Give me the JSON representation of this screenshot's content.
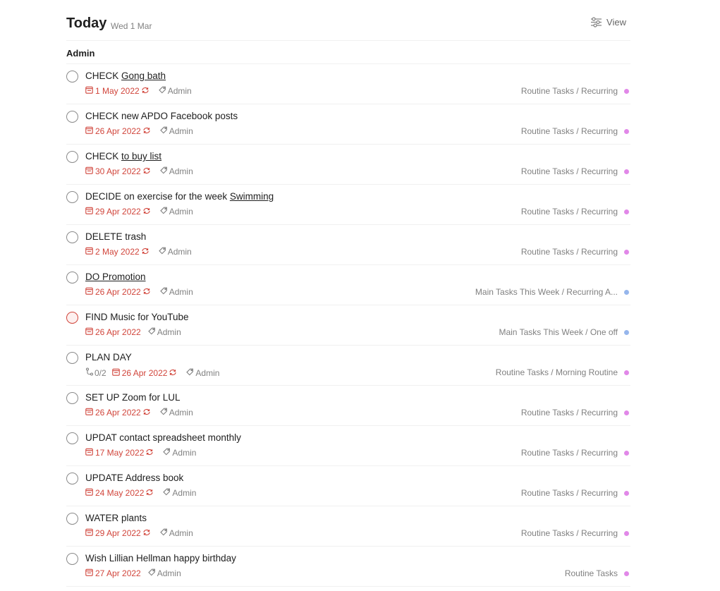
{
  "header": {
    "title": "Today",
    "date": "Wed 1 Mar",
    "view_label": "View"
  },
  "section": {
    "title": "Admin"
  },
  "colors": {
    "date_red": "#d1453b",
    "dot_purple": "#e188e8",
    "dot_blue": "#96b6ec",
    "text_gray": "#808080"
  },
  "tasks": [
    {
      "prefix": "CHECK ",
      "link": "Gong bath",
      "date": "1 May 2022",
      "recurring": true,
      "label": "Admin",
      "project": "Routine Tasks / Recurring",
      "dot": "#e188e8"
    },
    {
      "prefix": "CHECK new APDO Facebook posts",
      "link": "",
      "date": "26 Apr 2022",
      "recurring": true,
      "label": "Admin",
      "project": "Routine Tasks / Recurring",
      "dot": "#e188e8"
    },
    {
      "prefix": "CHECK ",
      "link": "to buy list",
      "date": "30 Apr 2022",
      "recurring": true,
      "label": "Admin",
      "project": "Routine Tasks / Recurring",
      "dot": "#e188e8"
    },
    {
      "prefix": "DECIDE on exercise for the week ",
      "link": "Swimming",
      "date": "29 Apr 2022",
      "recurring": true,
      "label": "Admin",
      "project": "Routine Tasks / Recurring",
      "dot": "#e188e8"
    },
    {
      "prefix": "DELETE trash",
      "link": "",
      "date": "2 May 2022",
      "recurring": true,
      "label": "Admin",
      "project": "Routine Tasks / Recurring",
      "dot": "#e188e8"
    },
    {
      "prefix": "",
      "link": "DO Promotion",
      "date": "26 Apr 2022",
      "recurring": true,
      "label": "Admin",
      "project": "Main Tasks This Week / Recurring A...",
      "dot": "#96b6ec"
    },
    {
      "prefix": "FIND Music for YouTube",
      "link": "",
      "date": "26 Apr 2022",
      "recurring": false,
      "label": "Admin",
      "project": "Main Tasks This Week / One off",
      "dot": "#96b6ec",
      "priority": true
    },
    {
      "prefix": "PLAN DAY",
      "link": "",
      "subtasks": "0/2",
      "date": "26 Apr 2022",
      "recurring": true,
      "label": "Admin",
      "project": "Routine Tasks / Morning Routine",
      "dot": "#e188e8"
    },
    {
      "prefix": "SET UP Zoom for LUL",
      "link": "",
      "date": "26 Apr 2022",
      "recurring": true,
      "label": "Admin",
      "project": "Routine Tasks / Recurring",
      "dot": "#e188e8"
    },
    {
      "prefix": "UPDAT contact spreadsheet monthly",
      "link": "",
      "date": "17 May 2022",
      "recurring": true,
      "label": "Admin",
      "project": "Routine Tasks / Recurring",
      "dot": "#e188e8"
    },
    {
      "prefix": "UPDATE Address book",
      "link": "",
      "date": "24 May 2022",
      "recurring": true,
      "label": "Admin",
      "project": "Routine Tasks / Recurring",
      "dot": "#e188e8"
    },
    {
      "prefix": "WATER plants",
      "link": "",
      "date": "29 Apr 2022",
      "recurring": true,
      "label": "Admin",
      "project": "Routine Tasks / Recurring",
      "dot": "#e188e8"
    },
    {
      "prefix": "Wish Lillian Hellman happy birthday",
      "link": "",
      "date": "27 Apr 2022",
      "recurring": false,
      "label": "Admin",
      "project": "Routine Tasks",
      "dot": "#e188e8"
    }
  ]
}
